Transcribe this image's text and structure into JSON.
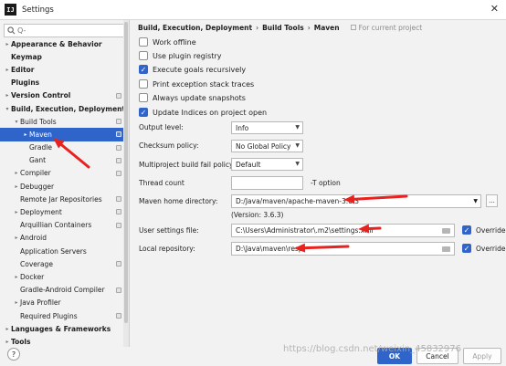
{
  "window": {
    "title": "Settings",
    "app_icon_text": "IJ"
  },
  "search": {
    "placeholder": "Q-"
  },
  "sidebar": {
    "items": [
      {
        "label": "Appearance & Behavior",
        "bold": true,
        "arrow": "▸",
        "level": 0
      },
      {
        "label": "Keymap",
        "bold": true,
        "arrow": "",
        "level": 0
      },
      {
        "label": "Editor",
        "bold": true,
        "arrow": "▸",
        "level": 0
      },
      {
        "label": "Plugins",
        "bold": true,
        "arrow": "",
        "level": 0
      },
      {
        "label": "Version Control",
        "bold": true,
        "arrow": "▸",
        "level": 0,
        "config": true
      },
      {
        "label": "Build, Execution, Deployment",
        "bold": true,
        "arrow": "▾",
        "level": 0
      },
      {
        "label": "Build Tools",
        "bold": false,
        "arrow": "▾",
        "level": 1,
        "config": true
      },
      {
        "label": "Maven",
        "bold": false,
        "arrow": "▸",
        "level": 2,
        "config": true,
        "selected": true
      },
      {
        "label": "Gradle",
        "bold": false,
        "arrow": "",
        "level": 2,
        "config": true
      },
      {
        "label": "Gant",
        "bold": false,
        "arrow": "",
        "level": 2,
        "config": true
      },
      {
        "label": "Compiler",
        "bold": false,
        "arrow": "▸",
        "level": 1,
        "config": true
      },
      {
        "label": "Debugger",
        "bold": false,
        "arrow": "▸",
        "level": 1
      },
      {
        "label": "Remote Jar Repositories",
        "bold": false,
        "arrow": "",
        "level": 1,
        "config": true
      },
      {
        "label": "Deployment",
        "bold": false,
        "arrow": "▸",
        "level": 1,
        "config": true
      },
      {
        "label": "Arquillian Containers",
        "bold": false,
        "arrow": "",
        "level": 1,
        "config": true
      },
      {
        "label": "Android",
        "bold": false,
        "arrow": "▸",
        "level": 1
      },
      {
        "label": "Application Servers",
        "bold": false,
        "arrow": "",
        "level": 1
      },
      {
        "label": "Coverage",
        "bold": false,
        "arrow": "",
        "level": 1,
        "config": true
      },
      {
        "label": "Docker",
        "bold": false,
        "arrow": "▸",
        "level": 1
      },
      {
        "label": "Gradle-Android Compiler",
        "bold": false,
        "arrow": "",
        "level": 1,
        "config": true
      },
      {
        "label": "Java Profiler",
        "bold": false,
        "arrow": "▸",
        "level": 1
      },
      {
        "label": "Required Plugins",
        "bold": false,
        "arrow": "",
        "level": 1,
        "config": true
      },
      {
        "label": "Languages & Frameworks",
        "bold": true,
        "arrow": "▸",
        "level": 0
      },
      {
        "label": "Tools",
        "bold": true,
        "arrow": "▸",
        "level": 0
      }
    ]
  },
  "breadcrumb": {
    "part1": "Build, Execution, Deployment",
    "sep1": "›",
    "part2": "Build Tools",
    "sep2": "›",
    "part3": "Maven",
    "for_project": "For current project"
  },
  "options": [
    {
      "label": "Work offline",
      "checked": false
    },
    {
      "label": "Use plugin registry",
      "checked": false
    },
    {
      "label": "Execute goals recursively",
      "checked": true
    },
    {
      "label": "Print exception stack traces",
      "checked": false
    },
    {
      "label": "Always update snapshots",
      "checked": false
    },
    {
      "label": "Update Indices on project open",
      "checked": true
    }
  ],
  "fields": {
    "output_level_label": "Output level:",
    "output_level_value": "Info",
    "checksum_label": "Checksum policy:",
    "checksum_value": "No Global Policy",
    "multiproject_label": "Multiproject build fail policy:",
    "multiproject_value": "Default",
    "thread_count_label": "Thread count",
    "thread_count_value": "",
    "thread_count_hint": "-T option",
    "maven_home_label": "Maven home directory:",
    "maven_home_value": "D:/Java/maven/apache-maven-3.6.3",
    "maven_version": "(Version: 3.6.3)",
    "user_settings_label": "User settings file:",
    "user_settings_value": "C:\\Users\\Administrator\\.m2\\settings.xml",
    "local_repo_label": "Local repository:",
    "local_repo_value": "D:\\Java\\maven\\resp",
    "override_label": "Override",
    "browse_label": "..."
  },
  "footer": {
    "help": "?",
    "ok": "OK",
    "cancel": "Cancel",
    "apply": "Apply"
  },
  "watermark": "https://blog.csdn.net/weixin_45832976",
  "colors": {
    "accent": "#2f65ca",
    "annotation_arrow": "#e8231f"
  }
}
